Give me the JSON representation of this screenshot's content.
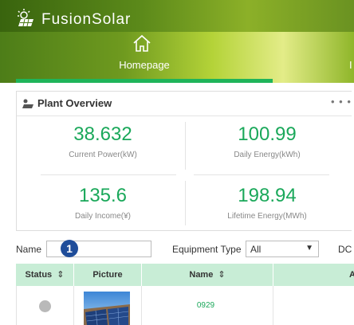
{
  "app": {
    "title": "FusionSolar"
  },
  "nav": {
    "active_tab": "Homepage"
  },
  "overview": {
    "title": "Plant Overview",
    "more": "• • •",
    "metrics": [
      {
        "value": "38.632",
        "label": "Current Power(kW)"
      },
      {
        "value": "100.99",
        "label": "Daily Energy(kWh)"
      },
      {
        "value": "135.6",
        "label": "Daily Income(¥)"
      },
      {
        "value": "198.94",
        "label": "Lifetime Energy(MWh)"
      }
    ]
  },
  "filters": {
    "name_label": "Name",
    "name_value": "",
    "badge": "1",
    "equipment_label": "Equipment Type",
    "equipment_value": "All",
    "dc_label": "DC"
  },
  "table": {
    "columns": [
      "Status",
      "Picture",
      "Name",
      "A"
    ],
    "sort_symbol": "⇕",
    "rows": [
      {
        "status": "offline",
        "name": "0929"
      }
    ]
  },
  "colors": {
    "accent": "#1aa85a",
    "header_green": "#5c8a1a",
    "table_header": "#c8edd6",
    "badge": "#1f4d9a"
  },
  "icons": [
    "sun-panel-logo-icon",
    "home-icon",
    "plant-overview-icon",
    "more-icon",
    "dropdown-arrow-icon",
    "sort-icon"
  ]
}
